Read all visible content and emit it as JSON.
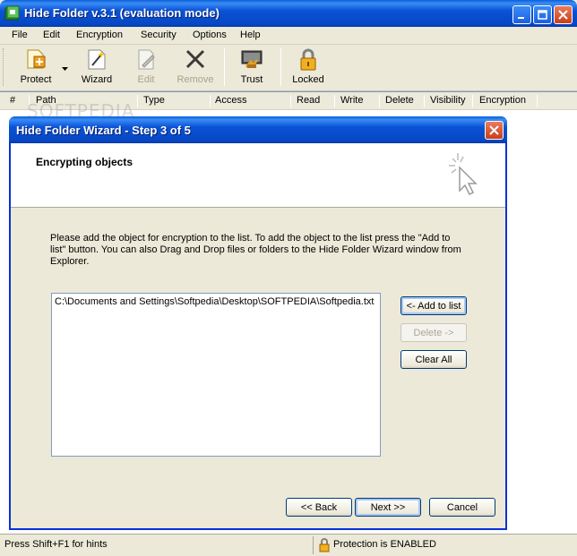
{
  "window": {
    "title": "Hide Folder v.3.1 (evaluation mode)"
  },
  "menu": [
    "File",
    "Edit",
    "Encryption",
    "Security",
    "Options",
    "Help"
  ],
  "toolbar": {
    "protect": "Protect",
    "wizard": "Wizard",
    "edit": "Edit",
    "remove": "Remove",
    "trust": "Trust",
    "locked": "Locked"
  },
  "columns": [
    "#",
    "Path",
    "Type",
    "Access",
    "Read",
    "Write",
    "Delete",
    "Visibility",
    "Encryption"
  ],
  "watermark": "SOFTPEDIA",
  "dialog": {
    "title": "Hide Folder Wizard - Step 3 of 5",
    "heading": "Encrypting objects",
    "instructions": "Please add the object for encryption to the list. To add the object to the list press the \"Add to list\" button. You can also Drag and Drop files or folders to the Hide Folder Wizard window from Explorer.",
    "items": [
      "C:\\Documents and Settings\\Softpedia\\Desktop\\SOFTPEDIA\\Softpedia.txt"
    ],
    "add_button": "<- Add to list",
    "delete_button": "Delete ->",
    "clear_button": "Clear All",
    "back_button": "<< Back",
    "next_button": "Next >>",
    "cancel_button": "Cancel"
  },
  "status": {
    "hint": "Press Shift+F1 for hints",
    "protection": "Protection is ENABLED"
  }
}
